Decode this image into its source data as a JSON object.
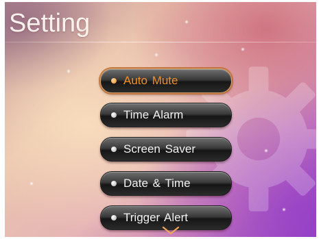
{
  "header": {
    "title": "Setting"
  },
  "menu": {
    "items": [
      {
        "label": "Auto Mute",
        "selected": true
      },
      {
        "label": "Time Alarm",
        "selected": false
      },
      {
        "label": "Screen Saver",
        "selected": false
      },
      {
        "label": "Date & Time",
        "selected": false
      },
      {
        "label": "Trigger Alert",
        "selected": false
      }
    ]
  },
  "icons": {
    "background": "gear-icon",
    "bullet": "bullet-dot-icon",
    "scroll": "chevron-down-icon"
  },
  "colors": {
    "accent": "#f5901f",
    "button_text": "#f2f2f2",
    "title_text": "#fbf2ee"
  }
}
